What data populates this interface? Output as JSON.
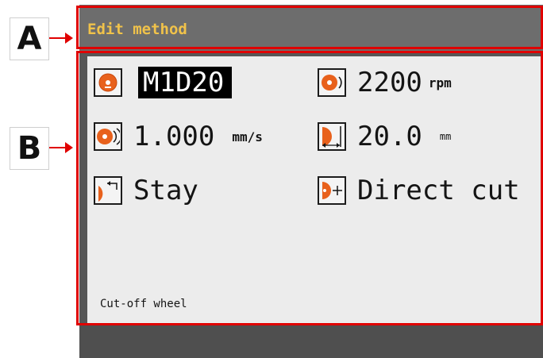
{
  "callouts": {
    "a": "A",
    "b": "B"
  },
  "screen": {
    "title": "Edit method",
    "footer": "Cut-off wheel"
  },
  "rows": [
    {
      "icon": "wheel-icon",
      "value": "M1D20",
      "unit": ""
    },
    {
      "icon": "rotation-speed-icon",
      "value": "2200",
      "unit": "rpm"
    },
    {
      "icon": "feed-speed-icon",
      "value": "1.000",
      "unit": "mm/s"
    },
    {
      "icon": "cut-length-icon",
      "value": "20.0",
      "unit": "mm"
    },
    {
      "icon": "return-icon",
      "value": "Stay",
      "unit": ""
    },
    {
      "icon": "direct-cut-icon",
      "value": "Direct cut",
      "unit": ""
    }
  ],
  "colors": {
    "title": "#f0c24a",
    "annotation": "#e00000",
    "icon_accent": "#e8611c",
    "titlebar": "#6d6d6d",
    "panel": "#ececec"
  }
}
